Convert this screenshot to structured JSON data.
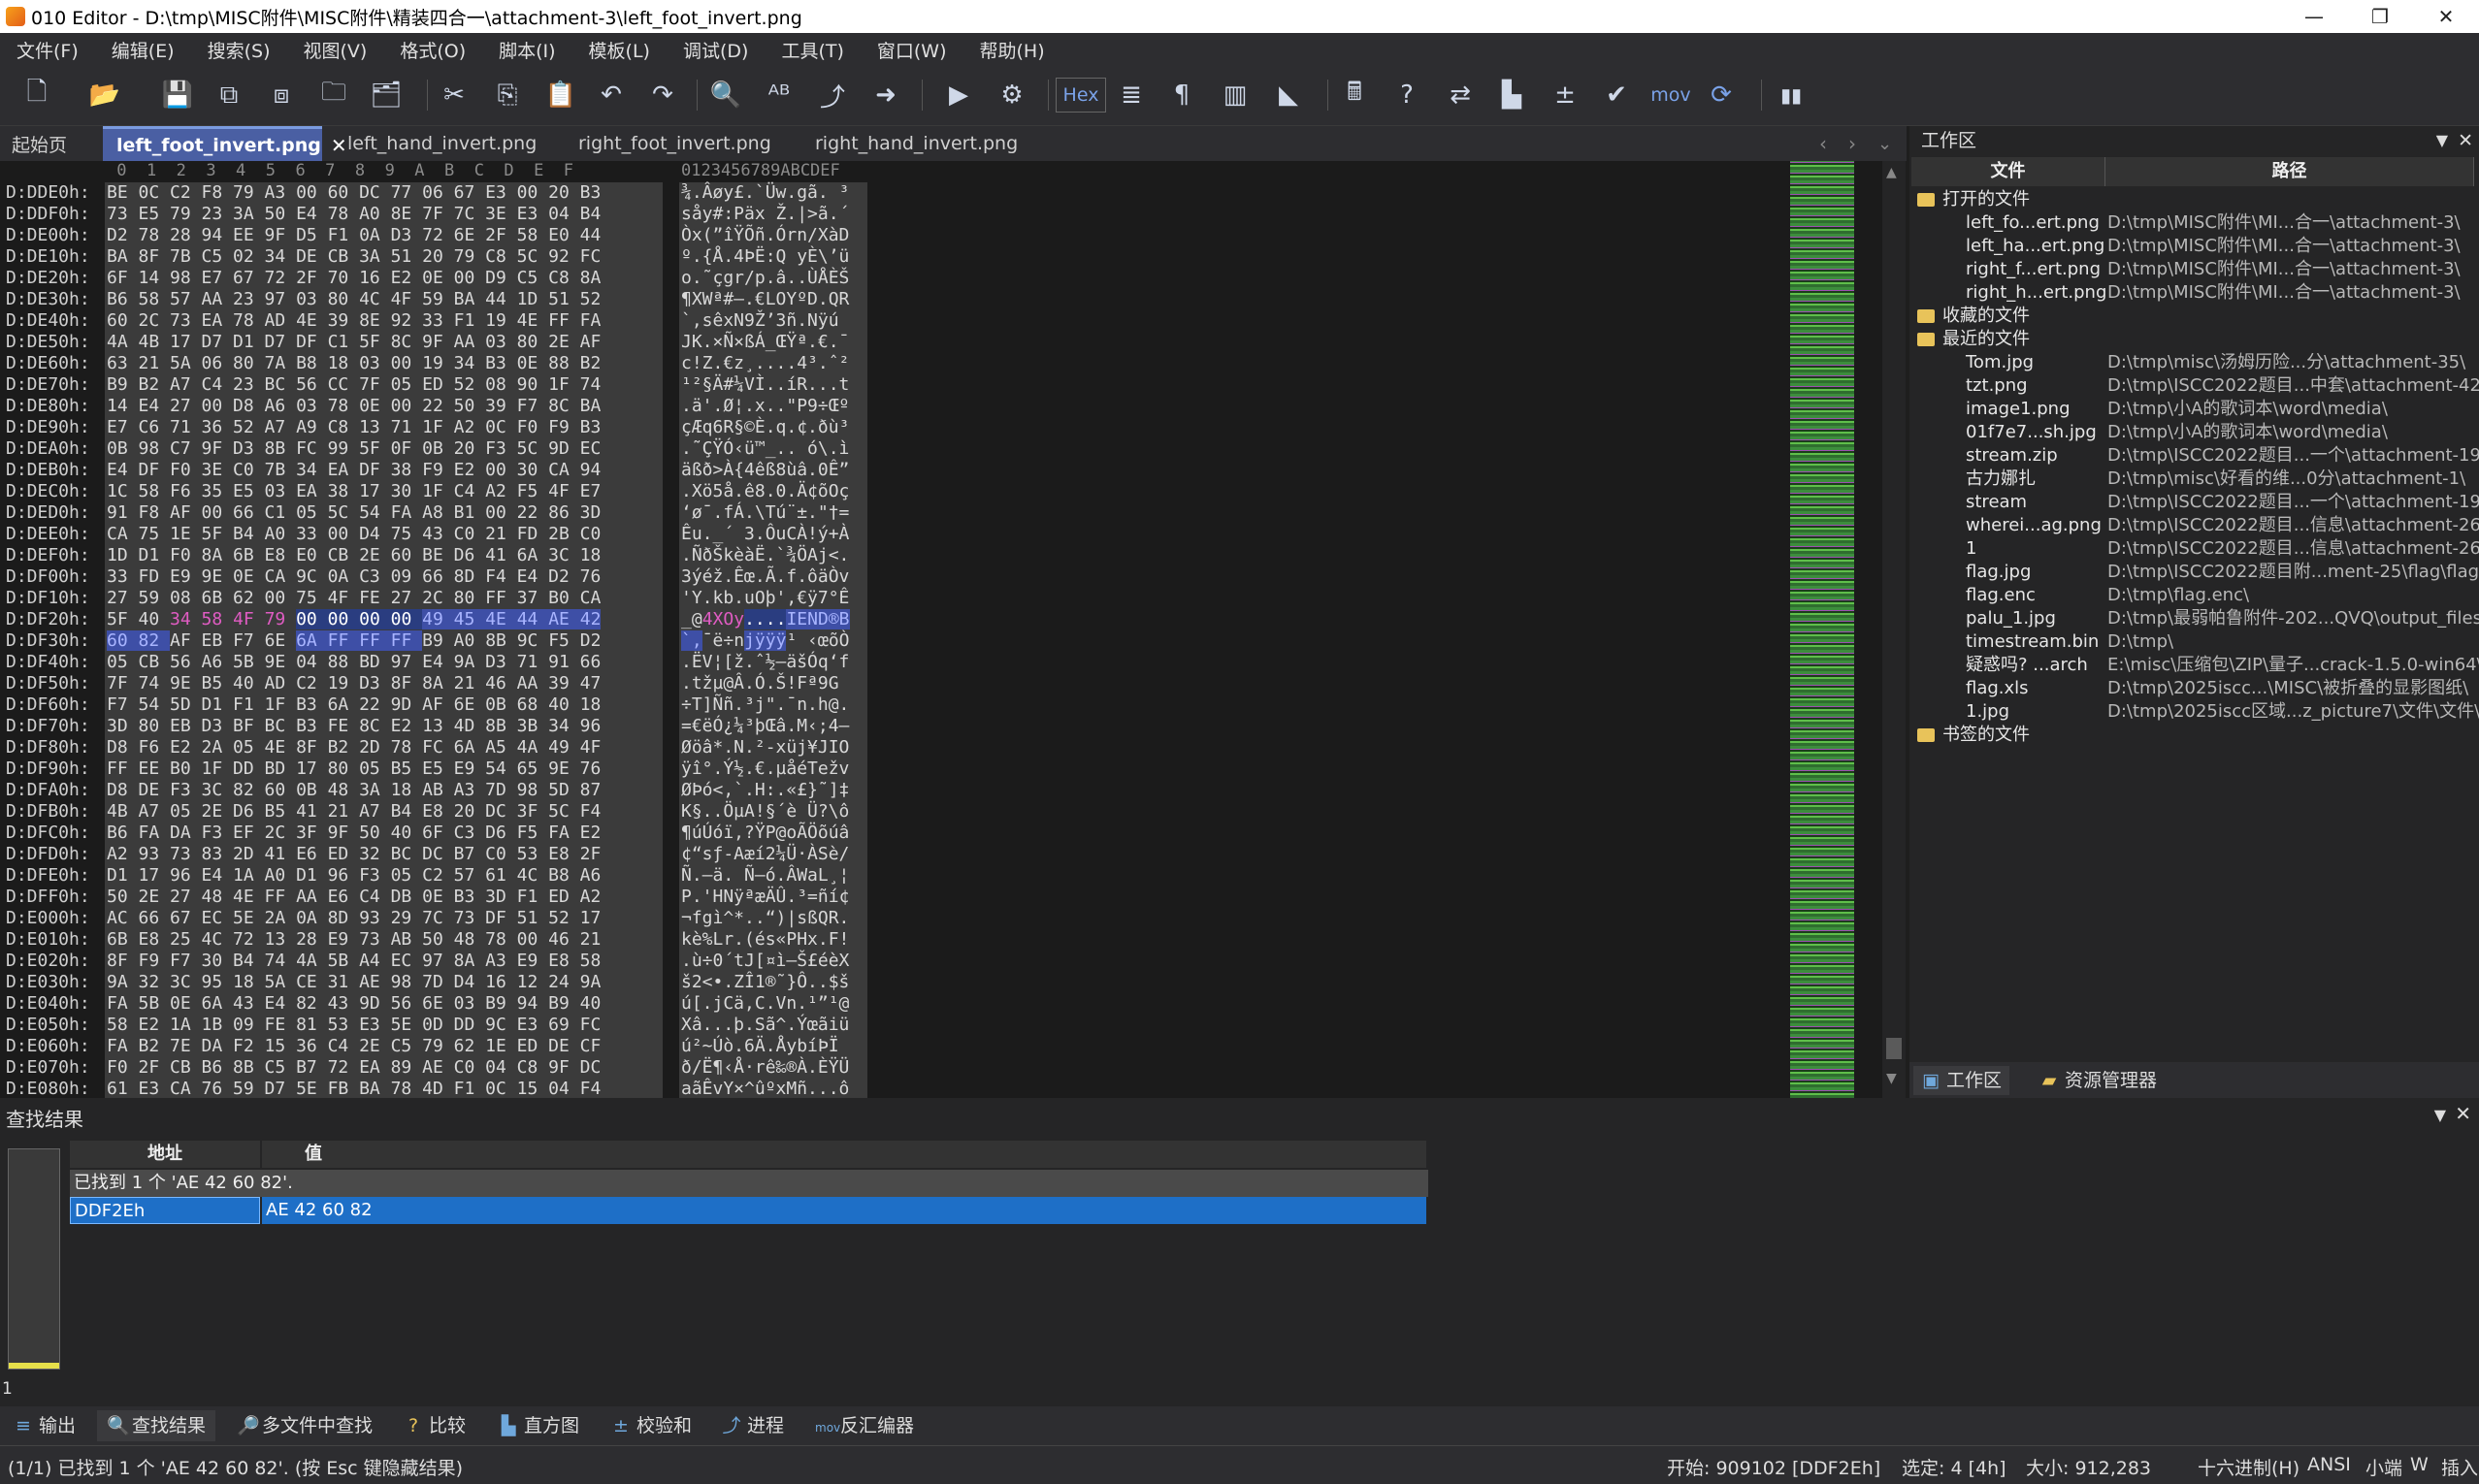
{
  "window": {
    "title": "010 Editor - D:\\tmp\\MISC附件\\MISC附件\\精装四合一\\attachment-3\\left_foot_invert.png",
    "minimize": "—",
    "maximize": "❐",
    "close": "✕"
  },
  "menu": [
    "文件(F)",
    "编辑(E)",
    "搜索(S)",
    "视图(V)",
    "格式(O)",
    "脚本(I)",
    "模板(L)",
    "调试(D)",
    "工具(T)",
    "窗口(W)",
    "帮助(H)"
  ],
  "toolbar": {
    "hex_label": "Hex",
    "mov_label": "mov"
  },
  "tabs": [
    {
      "label": "起始页"
    },
    {
      "label": "left_foot_invert.png",
      "active": true
    },
    {
      "label": "left_hand_invert.png"
    },
    {
      "label": "right_foot_invert.png"
    },
    {
      "label": "right_hand_invert.png"
    }
  ],
  "hex": {
    "col_header": " 0  1  2  3  4  5  6  7  8  9  A  B  C  D  E  F",
    "ascii_header": "0123456789ABCDEF",
    "rows": [
      {
        "addr": "D:DDE0h:",
        "hex": "BE 0C C2 F8 79 A3 00 60 DC 77 06 67 E3 00 20 B3",
        "ascii": "¾.Âøy£.`Üw.gã. ³"
      },
      {
        "addr": "D:DDF0h:",
        "hex": "73 E5 79 23 3A 50 E4 78 A0 8E 7F 7C 3E E3 04 B4",
        "ascii": "såy#:Päx Ž.|>ã.´"
      },
      {
        "addr": "D:DE00h:",
        "hex": "D2 78 28 94 EE 9F D5 F1 0A D3 72 6E 2F 58 E0 44",
        "ascii": "Òx(”îŸÕñ.Órn/XàD"
      },
      {
        "addr": "D:DE10h:",
        "hex": "BA 8F 7B C5 02 34 DE CB 3A 51 20 79 C8 5C 92 FC",
        "ascii": "º.{Å.4ÞË:Q yÈ\\’ü"
      },
      {
        "addr": "D:DE20h:",
        "hex": "6F 14 98 E7 67 72 2F 70 16 E2 0E 00 D9 C5 C8 8A",
        "ascii": "o.˜çgr/p.â..ÙÅÈŠ"
      },
      {
        "addr": "D:DE30h:",
        "hex": "B6 58 57 AA 23 97 03 80 4C 4F 59 BA 44 1D 51 52",
        "ascii": "¶XWª#—.€LOYºD.QR"
      },
      {
        "addr": "D:DE40h:",
        "hex": "60 2C 73 EA 78 AD 4E 39 8E 92 33 F1 19 4E FF FA",
        "ascii": "`,sêx­N9Ž’3ñ.Nÿú"
      },
      {
        "addr": "D:DE50h:",
        "hex": "4A 4B 17 D7 D1 D7 DF C1 5F 8C 9F AA 03 80 2E AF",
        "ascii": "JK.×Ñ×ßÁ_ŒŸª.€.¯"
      },
      {
        "addr": "D:DE60h:",
        "hex": "63 21 5A 06 80 7A B8 18 03 00 19 34 B3 0E 88 B2",
        "ascii": "c!Z.€z¸....4³.ˆ²"
      },
      {
        "addr": "D:DE70h:",
        "hex": "B9 B2 A7 C4 23 BC 56 CC 7F 05 ED 52 08 90 1F 74",
        "ascii": "¹²§Ä#¼VÌ..íR...t"
      },
      {
        "addr": "D:DE80h:",
        "hex": "14 E4 27 00 D8 A6 03 78 0E 00 22 50 39 F7 8C BA",
        "ascii": ".ä'.Ø¦.x..\"P9÷Œº"
      },
      {
        "addr": "D:DE90h:",
        "hex": "E7 C6 71 36 52 A7 A9 C8 13 71 1F A2 0C F0 F9 B3",
        "ascii": "çÆq6R§©È.q.¢.ðù³"
      },
      {
        "addr": "D:DEA0h:",
        "hex": "0B 98 C7 9F D3 8B FC 99 5F 0F 0B 20 F3 5C 9D EC",
        "ascii": ".˜ÇŸÓ‹ü™_.. ó\\.ì"
      },
      {
        "addr": "D:DEB0h:",
        "hex": "E4 DF F0 3E C0 7B 34 EA DF 38 F9 E2 00 30 CA 94",
        "ascii": "äßð>À{4êß8ùâ.0Ê”"
      },
      {
        "addr": "D:DEC0h:",
        "hex": "1C 58 F6 35 E5 03 EA 38 17 30 1F C4 A2 F5 4F E7",
        "ascii": ".Xö5å.ê8.0.Ä¢õOç"
      },
      {
        "addr": "D:DED0h:",
        "hex": "91 F8 AF 00 66 C1 05 5C 54 FA A8 B1 00 22 86 3D",
        "ascii": "‘ø¯.fÁ.\\Tú¨±.\"†="
      },
      {
        "addr": "D:DEE0h:",
        "hex": "CA 75 1E 5F B4 A0 33 00 D4 75 43 C0 21 FD 2B C0",
        "ascii": "Êu._´ 3.ÔuCÀ!ý+À"
      },
      {
        "addr": "D:DEF0h:",
        "hex": "1D D1 F0 8A 6B E8 E0 CB 2E 60 BE D6 41 6A 3C 18",
        "ascii": ".ÑðŠkèàË.`¾ÖAj<."
      },
      {
        "addr": "D:DF00h:",
        "hex": "33 FD E9 9E 0E CA 9C 0A C3 09 66 8D F4 E4 D2 76",
        "ascii": "3ýéž.Êœ.Ã.f.ôäÒv"
      },
      {
        "addr": "D:DF10h:",
        "hex": "27 59 08 6B 62 00 75 4F FE 27 2C 80 FF 37 B0 CA",
        "ascii": "'Y.kb.uOþ',€ÿ7°Ê"
      },
      {
        "addr": "D:DF20h:",
        "hex": "5F 40 34 58 4F 79 00 00 00 00 49 45 4E 44 AE 42",
        "ascii": "_@4XOy....IEND®B",
        "special": "iend"
      },
      {
        "addr": "D:DF30h:",
        "hex": "60 82 AF EB F7 6E 6A FF FF FF B9 A0 8B 9C F5 D2",
        "ascii": "`‚¯ë÷njÿÿÿ¹ ‹œõÒ",
        "special": "after"
      },
      {
        "addr": "D:DF40h:",
        "hex": "05 CB 56 A6 5B 9E 04 88 BD 97 E4 9A D3 71 91 66",
        "ascii": ".ËV¦[ž.ˆ½—äšÓq‘f"
      },
      {
        "addr": "D:DF50h:",
        "hex": "7F 74 9E B5 40 AD C2 19 D3 8F 8A 21 46 AA 39 47",
        "ascii": ".tžµ@­Â.Ó.Š!Fª9G"
      },
      {
        "addr": "D:DF60h:",
        "hex": "F7 54 5D D1 F1 1F B3 6A 22 9D AF 6E 0B 68 40 18",
        "ascii": "÷T]Ññ.³j\".¯n.h@."
      },
      {
        "addr": "D:DF70h:",
        "hex": "3D 80 EB D3 BF BC B3 FE 8C E2 13 4D 8B 3B 34 96",
        "ascii": "=€ëÓ¿¼³þŒâ.M‹;4–"
      },
      {
        "addr": "D:DF80h:",
        "hex": "D8 F6 E2 2A 05 4E 8F B2 2D 78 FC 6A A5 4A 49 4F",
        "ascii": "Øöâ*.N.²-xüj¥JIO"
      },
      {
        "addr": "D:DF90h:",
        "hex": "FF EE B0 1F DD BD 17 80 05 B5 E5 E9 54 65 9E 76",
        "ascii": "ÿî°.Ý½.€.µåéTežv"
      },
      {
        "addr": "D:DFA0h:",
        "hex": "D8 DE F3 3C 82 60 0B 48 3A 18 AB A3 7D 98 5D 87",
        "ascii": "ØÞó<‚`.H:.«£}˜]‡"
      },
      {
        "addr": "D:DFB0h:",
        "hex": "4B A7 05 2E D6 B5 41 21 A7 B4 E8 20 DC 3F 5C F4",
        "ascii": "K§..ÖµA!§´è Ü?\\ô"
      },
      {
        "addr": "D:DFC0h:",
        "hex": "B6 FA DA F3 EF 2C 3F 9F 50 40 6F C3 D6 F5 FA E2",
        "ascii": "¶úÚóï,?ŸP@oÃÖõúâ"
      },
      {
        "addr": "D:DFD0h:",
        "hex": "A2 93 73 83 2D 41 E6 ED 32 BC DC B7 C0 53 E8 2F",
        "ascii": "¢“sƒ-Aæí2¼Ü·ÀSè/"
      },
      {
        "addr": "D:DFE0h:",
        "hex": "D1 17 96 E4 1A A0 D1 96 F3 05 C2 57 61 4C B8 A6",
        "ascii": "Ñ.–ä. Ñ–ó.ÂWaL¸¦"
      },
      {
        "addr": "D:DFF0h:",
        "hex": "50 2E 27 48 4E FF AA E6 C4 DB 0E B3 3D F1 ED A2",
        "ascii": "P.'HNÿªæÄÛ.³=ñí¢"
      },
      {
        "addr": "D:E000h:",
        "hex": "AC 66 67 EC 5E 2A 0A 8D 93 29 7C 73 DF 51 52 17",
        "ascii": "¬fgì^*..“)|sßQR."
      },
      {
        "addr": "D:E010h:",
        "hex": "6B E8 25 4C 72 13 28 E9 73 AB 50 48 78 00 46 21",
        "ascii": "kè%Lr.(és«PHx.F!"
      },
      {
        "addr": "D:E020h:",
        "hex": "8F F9 F7 30 B4 74 4A 5B A4 EC 97 8A A3 E9 E8 58",
        "ascii": ".ù÷0´tJ[¤ì—Š£éèX"
      },
      {
        "addr": "D:E030h:",
        "hex": "9A 32 3C 95 18 5A CE 31 AE 98 7D D4 16 12 24 9A",
        "ascii": "š2<•.ZÎ1®˜}Ô..$š"
      },
      {
        "addr": "D:E040h:",
        "hex": "FA 5B 0E 6A 43 E4 82 43 9D 56 6E 03 B9 94 B9 40",
        "ascii": "ú[.jCä‚C.Vn.¹”¹@"
      },
      {
        "addr": "D:E050h:",
        "hex": "58 E2 1A 1B 09 FE 81 53 E3 5E 0D DD 9C E3 69 FC",
        "ascii": "Xâ...þ.Sã^.Ýœãiü"
      },
      {
        "addr": "D:E060h:",
        "hex": "FA B2 7E DA F2 15 36 C4 2E C5 79 62 1E ED DE CF",
        "ascii": "ú²~Úò.6Ä.ÅybíÞÏ"
      },
      {
        "addr": "D:E070h:",
        "hex": "F0 2F CB B6 8B C5 B7 72 EA 89 AE C0 04 C8 9F DC",
        "ascii": "ð/Ë¶‹Å·rê‰®À.ÈŸÜ"
      },
      {
        "addr": "D:E080h:",
        "hex": "61 E3 CA 76 59 D7 5E FB BA 78 4D F1 0C 15 04 F4",
        "ascii": "aãÊvY×^ûºxMñ...ô"
      }
    ]
  },
  "workspace": {
    "title": "工作区",
    "col_file": "文件",
    "col_path": "路径",
    "groups": [
      {
        "label": "打开的文件",
        "items": [
          {
            "name": "left_fo...ert.png",
            "path": "D:\\tmp\\MISC附件\\MI...合一\\attachment-3\\"
          },
          {
            "name": "left_ha...ert.png",
            "path": "D:\\tmp\\MISC附件\\MI...合一\\attachment-3\\"
          },
          {
            "name": "right_f...ert.png",
            "path": "D:\\tmp\\MISC附件\\MI...合一\\attachment-3\\"
          },
          {
            "name": "right_h...ert.png",
            "path": "D:\\tmp\\MISC附件\\MI...合一\\attachment-3\\"
          }
        ]
      },
      {
        "label": "收藏的文件",
        "items": []
      },
      {
        "label": "最近的文件",
        "items": [
          {
            "name": "Tom.jpg",
            "path": "D:\\tmp\\misc\\汤姆历险...分\\attachment-35\\"
          },
          {
            "name": "tzt.png",
            "path": "D:\\tmp\\ISCC2022题目...中套\\attachment-42\\"
          },
          {
            "name": "image1.png",
            "path": "D:\\tmp\\小A的歌词本\\word\\media\\"
          },
          {
            "name": "01f7e7...sh.jpg",
            "path": "D:\\tmp\\小A的歌词本\\word\\media\\"
          },
          {
            "name": "stream.zip",
            "path": "D:\\tmp\\ISCC2022题目...一个\\attachment-19\\"
          },
          {
            "name": "古力娜扎",
            "path": "D:\\tmp\\misc\\好看的维...0分\\attachment-1\\"
          },
          {
            "name": "stream",
            "path": "D:\\tmp\\ISCC2022题目...一个\\attachment-19\\"
          },
          {
            "name": "wherei...ag.png",
            "path": "D:\\tmp\\ISCC2022题目...信息\\attachment-26\\"
          },
          {
            "name": "1",
            "path": "D:\\tmp\\ISCC2022题目...信息\\attachment-26\\"
          },
          {
            "name": "flag.jpg",
            "path": "D:\\tmp\\ISCC2022题目附...ment-25\\flag\\flag\\"
          },
          {
            "name": "flag.enc",
            "path": "D:\\tmp\\flag.enc\\"
          },
          {
            "name": "palu_1.jpg",
            "path": "D:\\tmp\\最弱帕鲁附件-202...QVQ\\output_files\\"
          },
          {
            "name": "timestream.bin",
            "path": "D:\\tmp\\"
          },
          {
            "name": "疑惑吗? ...arch",
            "path": "E:\\misc\\压缩包\\ZIP\\量子...crack-1.5.0-win64\\"
          },
          {
            "name": "flag.xls",
            "path": "D:\\tmp\\2025iscc...\\MISC\\被折叠的显影图纸\\"
          },
          {
            "name": "1.jpg",
            "path": "D:\\tmp\\2025iscc区域...z_picture7\\文件\\文件\\"
          }
        ]
      },
      {
        "label": "书签的文件",
        "items": []
      }
    ],
    "tab_workspace": "工作区",
    "tab_explorer": "资源管理器"
  },
  "find": {
    "title": "查找结果",
    "col_addr": "地址",
    "col_value": "值",
    "summary": "已找到 1 个 'AE 42 60 82'.",
    "result_addr": "DDF2Eh",
    "result_value": "AE 42 60 82",
    "left_counter": "1"
  },
  "bottom_tabs": [
    "输出",
    "查找结果",
    "多文件中查找",
    "比较",
    "直方图",
    "校验和",
    "进程",
    "反汇编器"
  ],
  "status": {
    "message": "(1/1) 已找到 1 个 'AE 42 60 82'. (按 Esc 键隐藏结果)",
    "start": "开始: 909102 [DDF2Eh]",
    "selected": "选定: 4 [4h]",
    "size": "大小: 912,283",
    "mode": "十六进制(H)",
    "encoding": "ANSI",
    "endian": "小端",
    "w": "W",
    "insert": "插入"
  }
}
